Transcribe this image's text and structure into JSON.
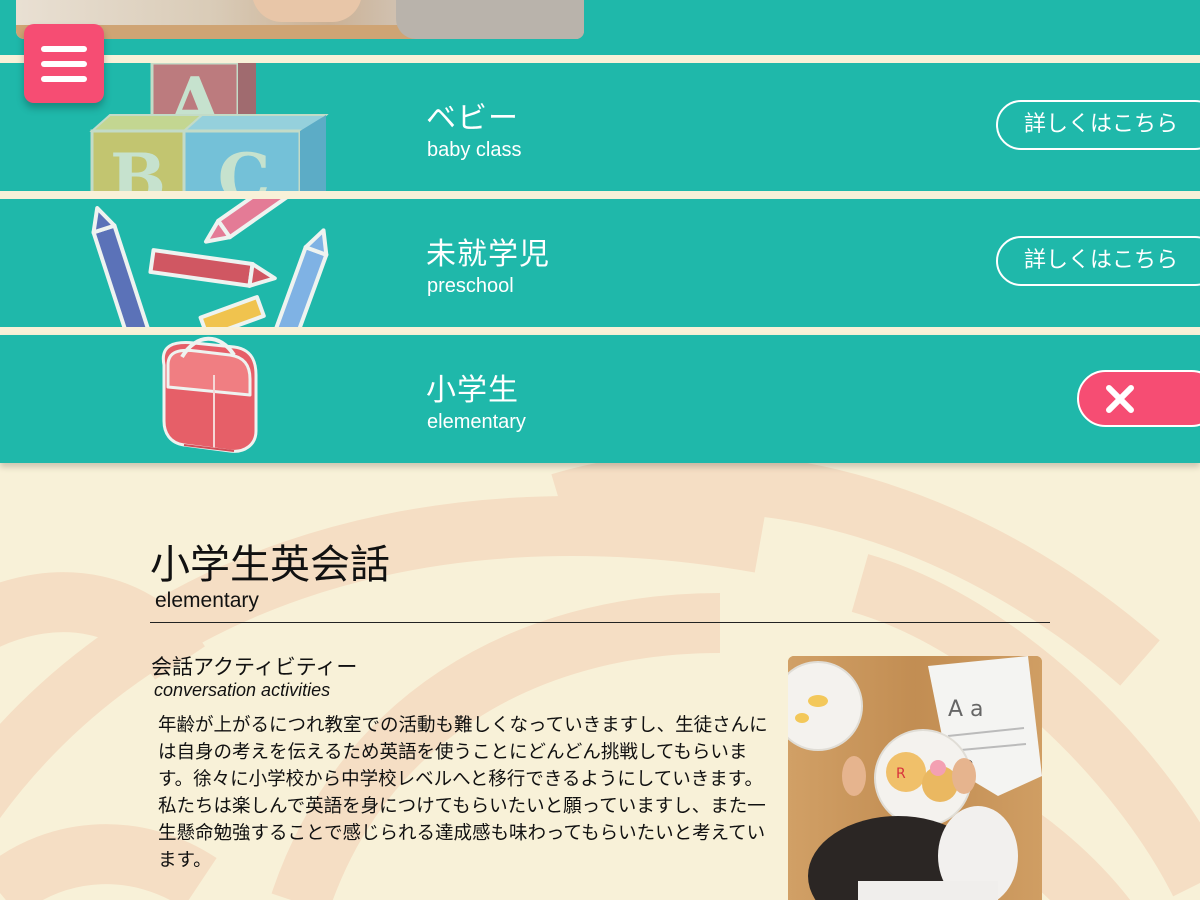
{
  "menu": {
    "icon": "hamburger-menu-icon"
  },
  "classes": [
    {
      "ja": "ベビー",
      "en": "baby class",
      "button_label": "詳しくはこちら",
      "illustration": "abc-blocks-icon"
    },
    {
      "ja": "未就学児",
      "en": "preschool",
      "button_label": "詳しくはこちら",
      "illustration": "crayons-icon"
    },
    {
      "ja": "小学生",
      "en": "elementary",
      "button_icon": "close-icon",
      "illustration": "school-backpack-icon"
    }
  ],
  "section": {
    "title": "小学生英会話",
    "subtitle": "elementary",
    "activity": {
      "title": "会話アクティビティー",
      "subtitle": "conversation activities",
      "body": "年齢が上がるにつれ教室での活動も難しくなっていきますし、生徒さんには自身の考えを伝えるため英語を使うことにどんどん挑戦してもらいます。徐々に小学校から中学校レベルへと移行できるようにしていきます。私たちは楽しんで英語を身につけてもらいたいと願っていますし、また一生懸命勉強することで感じられる達成感も味わってもらいたいと考えています。"
    }
  },
  "colors": {
    "teal": "#1fb8aa",
    "pink": "#f64d73",
    "cream": "#f8f1d8",
    "swirl": "#f5dcc0"
  }
}
